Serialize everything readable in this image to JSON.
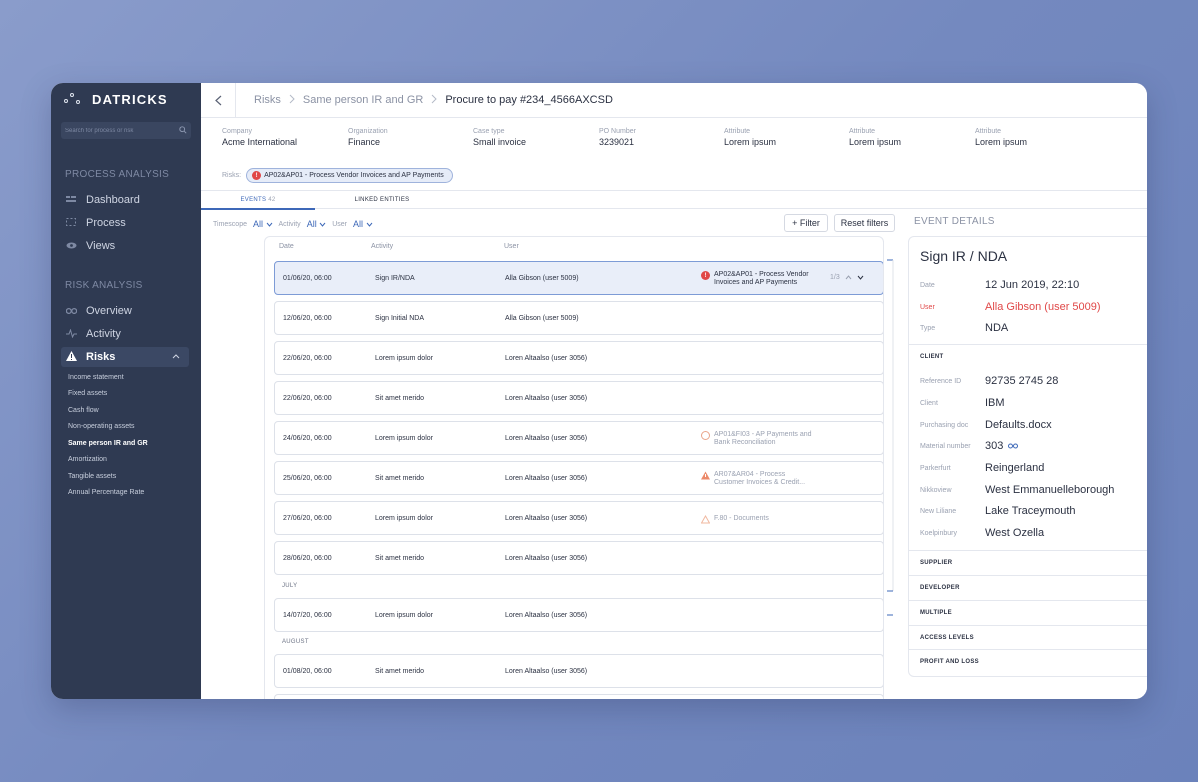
{
  "sidebar": {
    "logo": "DATRICKS",
    "search_placeholder": "Search for process or risk",
    "section_process": "PROCESS ANALYSIS",
    "process_items": [
      {
        "label": "Dashboard",
        "icon": "dashboard-icon"
      },
      {
        "label": "Process",
        "icon": "process-icon"
      },
      {
        "label": "Views",
        "icon": "eye-icon"
      }
    ],
    "section_risk": "RISK ANALYSIS",
    "risk_items": [
      {
        "label": "Overview",
        "icon": "binoculars-icon"
      },
      {
        "label": "Activity",
        "icon": "activity-icon"
      },
      {
        "label": "Risks",
        "icon": "warning-icon"
      }
    ],
    "risk_subitems": [
      "Income statement",
      "Fixed assets",
      "Cash flow",
      "Non-operating assets",
      "Same person IR and GR",
      "Amortization",
      "Tangible assets",
      "Annual Percentage Rate"
    ]
  },
  "breadcrumb": {
    "items": [
      "Risks",
      "Same person IR and GR",
      "Procure to pay #234_4566AXCSD"
    ]
  },
  "meta": [
    {
      "label": "Company",
      "value": "Acme International"
    },
    {
      "label": "Organization",
      "value": "Finance"
    },
    {
      "label": "Case type",
      "value": "Small invoice"
    },
    {
      "label": "PO Number",
      "value": "3239021"
    },
    {
      "label": "Attribute",
      "value": "Lorem ipsum"
    },
    {
      "label": "Attribute",
      "value": "Lorem ipsum"
    },
    {
      "label": "Attribute",
      "value": "Lorem ipsum"
    }
  ],
  "risks": {
    "label": "Risks:",
    "chip": "AP02&AP01 - Process Vendor Invoices and AP Payments"
  },
  "tabs": {
    "events": "EVENTS",
    "events_count": "42",
    "linked": "LINKED ENTITIES"
  },
  "filters": {
    "timescope_label": "Timescope",
    "timescope_value": "All",
    "activity_label": "Activity",
    "activity_value": "All",
    "user_label": "User",
    "user_value": "All",
    "filter_button": "+ Filter",
    "reset_button": "Reset filters"
  },
  "table": {
    "headers": [
      "Date",
      "Activity",
      "User"
    ],
    "rows": [
      {
        "date": "01/06/20, 06:00",
        "activity": "Sign IR/NDA",
        "user": "Alla Gibson (user 5009)",
        "risk": "AP02&AP01 - Process Vendor\nInvoices and AP Payments",
        "pager": "1/3"
      },
      {
        "date": "12/06/20, 06:00",
        "activity": "Sign Initial NDA",
        "user": "Alla Gibson (user 5009)"
      },
      {
        "date": "22/06/20, 06:00",
        "activity": "Lorem ipsum dolor",
        "user": "Loren Altaalso (user 3056)"
      },
      {
        "date": "22/06/20, 06:00",
        "activity": "Sit amet merido",
        "user": "Loren Altaalso (user 3056)"
      },
      {
        "date": "24/06/20, 06:00",
        "activity": "Lorem ipsum dolor",
        "user": "Loren Altaalso (user 3056)",
        "risk": "AP01&FI03 - AP Payments and\nBank Reconciliation"
      },
      {
        "date": "25/06/20, 06:00",
        "activity": "Sit amet merido",
        "user": "Loren Altaalso (user 3056)",
        "risk": "AR07&AR04 - Process\nCustomer Invoices & Credit..."
      },
      {
        "date": "27/06/20, 06:00",
        "activity": "Lorem ipsum dolor",
        "user": "Loren Altaalso (user 3056)",
        "risk": "F.80 - Documents"
      },
      {
        "date": "28/06/20, 06:00",
        "activity": "Sit amet merido",
        "user": "Loren Altaalso (user 3056)"
      },
      {
        "date": "14/07/20, 06:00",
        "activity": "Lorem ipsum dolor",
        "user": "Loren Altaalso (user 3056)"
      },
      {
        "date": "01/08/20, 06:00",
        "activity": "Sit amet merido",
        "user": "Loren Altaalso (user 3056)"
      }
    ],
    "month_july": "JULY",
    "month_august": "AUGUST"
  },
  "details": {
    "section_title": "EVENT DETAILS",
    "title": "Sign IR / NDA",
    "date_label": "Date",
    "date_value": "12 Jun 2019,  22:10",
    "user_label": "User",
    "user_value": "Alla Gibson (user 5009)",
    "type_label": "Type",
    "type_value": "NDA",
    "client_title": "CLIENT",
    "client_fields": [
      {
        "k": "Reference ID",
        "v": "92735 2745 28"
      },
      {
        "k": "Client",
        "v": "IBM"
      },
      {
        "k": "Purchasing doc",
        "v": "Defaults.docx"
      },
      {
        "k": "Material number",
        "v": "303"
      },
      {
        "k": "Parkerfurt",
        "v": "Reingerland"
      },
      {
        "k": "Nikkoview",
        "v": "West Emmanuelleborough"
      },
      {
        "k": "New Liliane",
        "v": "Lake Traceymouth"
      },
      {
        "k": "Koelpinbury",
        "v": "West Ozella"
      }
    ],
    "sections": [
      "SUPPLIER",
      "DEVELOPER",
      "MULTIPLE",
      "ACCESS LEVELS",
      "PROFIT AND LOSS"
    ]
  },
  "colors": {
    "sidebar": "#2f3a52",
    "accent": "#3d68b8",
    "danger": "#e04848"
  }
}
